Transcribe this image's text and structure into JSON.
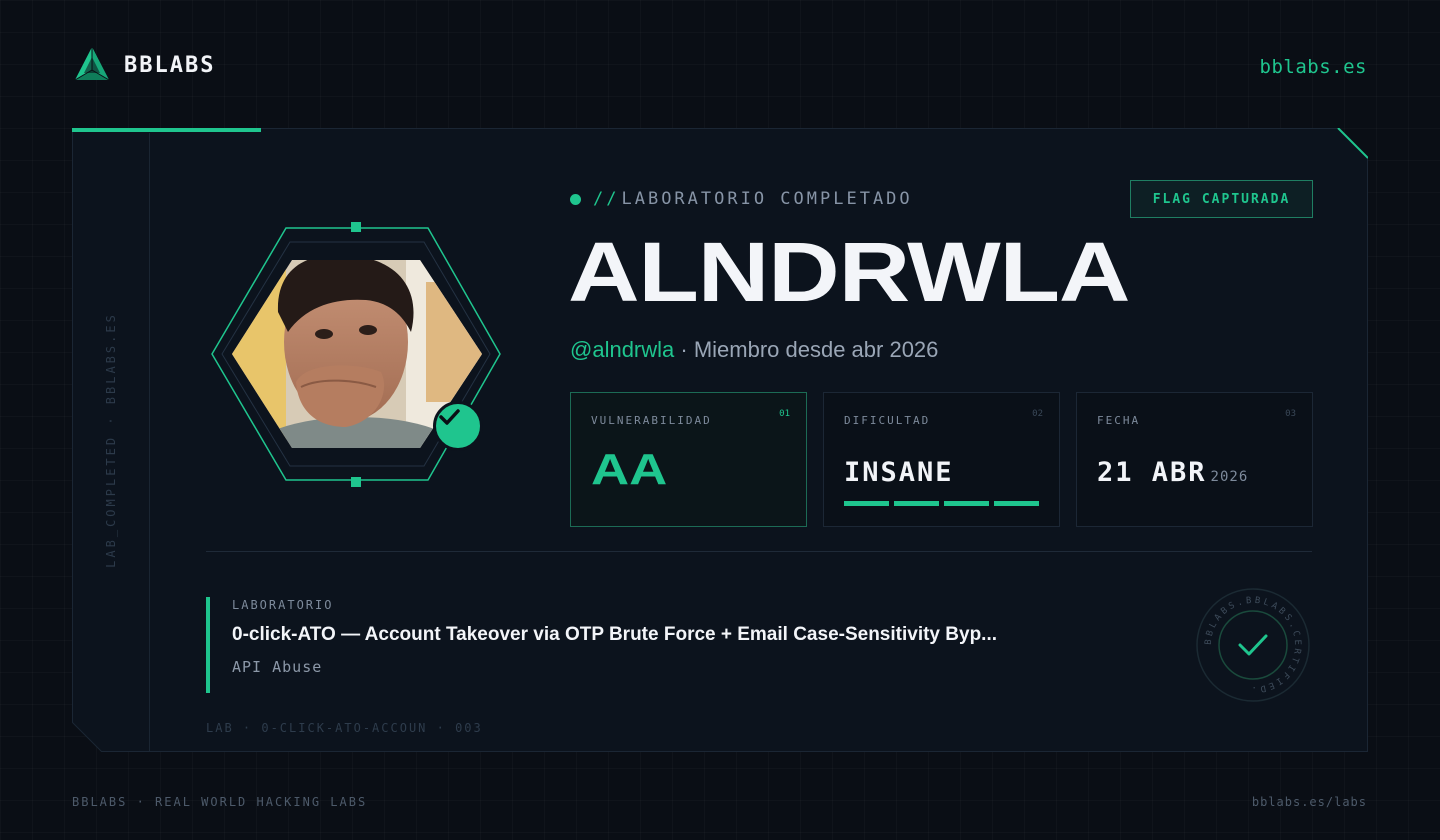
{
  "brand": {
    "name": "BBLABS",
    "logo_icon": "prism-triangle-logo-icon",
    "url": "bblabs.es"
  },
  "card": {
    "vertical_text": "LAB_COMPLETED · BBLABS.ES",
    "status": {
      "slashes": "//",
      "label": "LABORATORIO COMPLETADO"
    },
    "flag_chip": "FLAG CAPTURADA",
    "username": "ALNDRWLA",
    "handle": "@alndrwla",
    "member_since": " · Miembro desde abr 2026",
    "stats": [
      {
        "label": "VULNERABILIDAD",
        "num": "01",
        "value": "AA"
      },
      {
        "label": "DIFICULTAD",
        "num": "02",
        "value": "INSANE",
        "level": 4,
        "max_level": 4
      },
      {
        "label": "FECHA",
        "num": "03",
        "value": "21 ABR",
        "year": "2026"
      }
    ],
    "lab": {
      "label": "LABORATORIO",
      "title": "0-click-ATO — Account Takeover via OTP Brute Force + Email Case-Sensitivity Byp...",
      "category": "API Abuse"
    },
    "lab_code": "LAB · 0-CLICK-ATO-ACCOUN · 003",
    "seal_text": "BBLABS.BBLABS.CERTIFIED.",
    "avatar": {
      "description_icon": "avatar-photo",
      "verified_icon": "check-icon"
    }
  },
  "footer": {
    "left": "BBLABS · REAL WORLD HACKING LABS",
    "right": "bblabs.es/labs"
  },
  "colors": {
    "accent": "#1fc58e",
    "background": "#0a0e15",
    "card": "#0c131d"
  }
}
